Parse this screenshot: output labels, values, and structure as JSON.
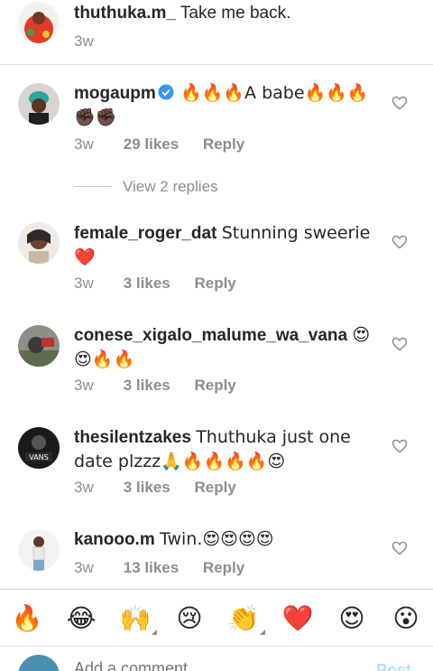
{
  "comments": [
    {
      "username": "thuthuka.m_",
      "text": "Take me back.",
      "time": "3w",
      "likes": "",
      "reply": ""
    },
    {
      "username": "mogaupm",
      "verified": true,
      "text": "🔥🔥🔥A babe🔥🔥🔥✊🏿✊🏿",
      "time": "3w",
      "likes": "29 likes",
      "reply": "Reply",
      "view_replies": "View 2 replies"
    },
    {
      "username": "female_roger_dat",
      "text": "Stunning sweerie ❤️",
      "time": "3w",
      "likes": "3 likes",
      "reply": "Reply"
    },
    {
      "username": "conese_xigalo_malume_wa_vana",
      "text": "😍😍🔥🔥",
      "time": "3w",
      "likes": "3 likes",
      "reply": "Reply"
    },
    {
      "username": "thesilentzakes",
      "text": "Thuthuka just one date plzzz🙏🔥🔥🔥🔥😍",
      "time": "3w",
      "likes": "3 likes",
      "reply": "Reply"
    },
    {
      "username": "kanooo.m",
      "text": "Twin.😍😍😍😍",
      "time": "3w",
      "likes": "13 likes",
      "reply": "Reply"
    }
  ],
  "reactions": [
    "🔥",
    "😂",
    "🙌",
    "😢",
    "👏",
    "❤️",
    "😍",
    "😮"
  ],
  "composer": {
    "placeholder": "Add a comment...",
    "post_label": "Post"
  },
  "colors": {
    "meta": "#8e8e8e",
    "text": "#262626",
    "divider": "#dbdbdb",
    "verified": "#3897f0",
    "heart_red": "#ed4956"
  }
}
